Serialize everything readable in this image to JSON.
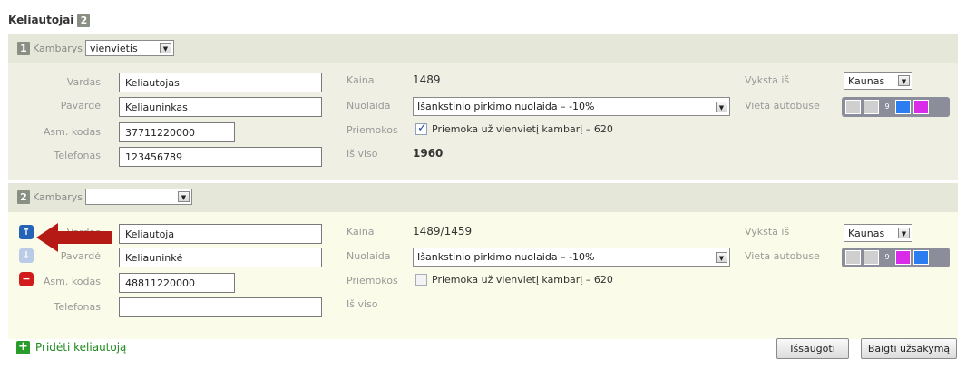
{
  "header": {
    "title": "Keliautojai",
    "count": "2"
  },
  "travelers": [
    {
      "index": "1",
      "room_label": "Kambarys",
      "room_value": "vienvietis",
      "labels": {
        "first_name": "Vardas",
        "last_name": "Pavardė",
        "id": "Asm. kodas",
        "phone": "Telefonas",
        "price": "Kaina",
        "discount": "Nuolaida",
        "extras": "Priemokos",
        "total": "Iš viso",
        "departs": "Vyksta iš",
        "bus_seat": "Vieta autobuse"
      },
      "first_name": "Keliautojas",
      "last_name": "Keliauninkas",
      "id_code": "37711220000",
      "phone": "123456789",
      "price": "1489",
      "discount": "Išankstinio pirkimo nuolaida – -10%",
      "extra_label": "Priemoka už vienvietį kambarį – 620",
      "extra_checked": true,
      "total": "1960",
      "departs_from": "Kaunas",
      "seat_number": "9"
    },
    {
      "index": "2",
      "room_label": "Kambarys",
      "room_value": "",
      "labels": {
        "first_name": "Vardas",
        "last_name": "Pavardė",
        "id": "Asm. kodas",
        "phone": "Telefonas",
        "price": "Kaina",
        "discount": "Nuolaida",
        "extras": "Priemokos",
        "total": "Iš viso",
        "departs": "Vyksta iš",
        "bus_seat": "Vieta autobuse"
      },
      "first_name": "Keliautoja",
      "last_name": "Keliauninkė",
      "id_code": "48811220000",
      "phone": "",
      "price": "1489/1459",
      "discount": "Išankstinio pirkimo nuolaida – -10%",
      "extra_label": "Priemoka už vienvietį kambarį – 620",
      "extra_checked": false,
      "total": "",
      "departs_from": "Kaunas",
      "seat_number": "9"
    }
  ],
  "actions": {
    "add_traveler": "Pridėti keliautoją",
    "save": "Išsaugoti",
    "finish": "Baigti užsakymą"
  },
  "colors": {
    "accent_blue": "#2c7ef0",
    "accent_magenta": "#d92ce8",
    "arrow_red": "#b51a14"
  }
}
